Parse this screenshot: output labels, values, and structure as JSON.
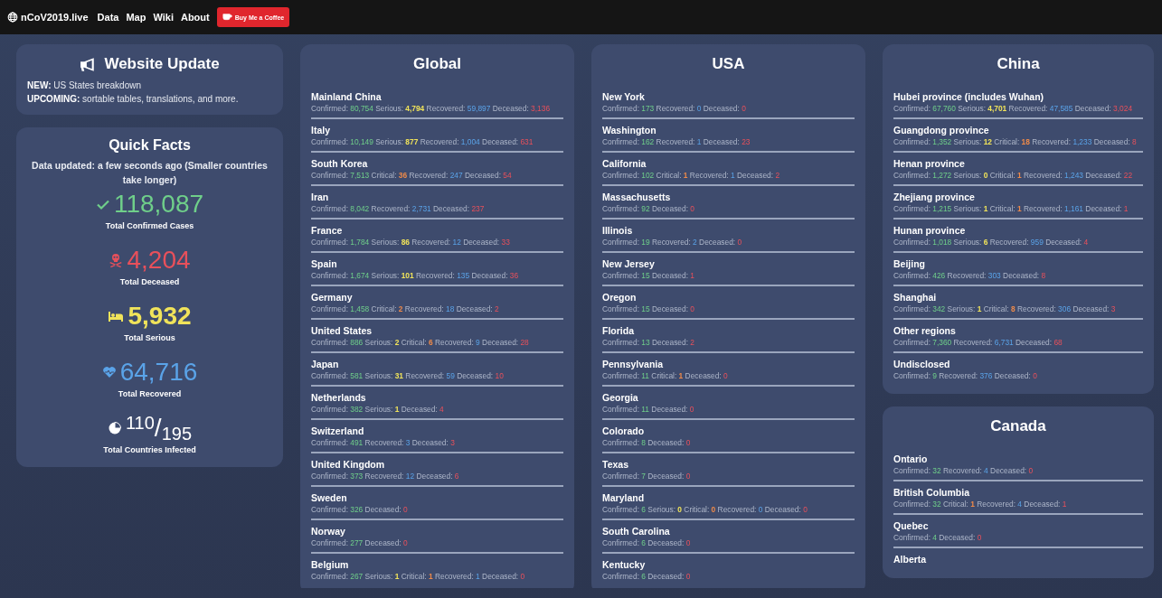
{
  "nav": {
    "brand": "nCoV2019.live",
    "links": [
      "Data",
      "Map",
      "Wiki",
      "About"
    ],
    "coffee_button": "Buy Me a Coffee"
  },
  "website_update": {
    "title": "Website Update",
    "lines": [
      "**NEW:** US States breakdown",
      "**UPCOMING:** sortable tables, translations, and more."
    ]
  },
  "quick_facts": {
    "title": "Quick Facts",
    "updated": "Data updated: a few seconds ago (Smaller countries take longer)",
    "facts": [
      {
        "kind": "confirmed",
        "value": "118,087",
        "label": "Total Confirmed Cases"
      },
      {
        "kind": "deceased",
        "value": "4,204",
        "label": "Total Deceased"
      },
      {
        "kind": "serious",
        "value": "5,932",
        "label": "Total Serious"
      },
      {
        "kind": "recovered",
        "value": "64,716",
        "label": "Total Recovered"
      },
      {
        "kind": "countries",
        "value": "$^{110}$/$_{195}$",
        "label": "Total Countries Infected"
      }
    ]
  },
  "region_columns": [
    {
      "panels": [
        {
          "title": "Global",
          "regions": [
            {
              "name": "Mainland China",
              "stats": [
                {
                  "kind": "confirmed",
                  "label": "Confirmed:",
                  "value": "80,754"
                },
                {
                  "kind": "serious",
                  "label": "Serious:",
                  "value": "4,794"
                },
                {
                  "kind": "recovered",
                  "label": "Recovered:",
                  "value": "59,897"
                },
                {
                  "kind": "deceased",
                  "label": "Deceased:",
                  "value": "3,136"
                }
              ]
            },
            {
              "name": "Italy",
              "stats": [
                {
                  "kind": "confirmed",
                  "label": "Confirmed:",
                  "value": "10,149"
                },
                {
                  "kind": "serious",
                  "label": "Serious:",
                  "value": "877"
                },
                {
                  "kind": "recovered",
                  "label": "Recovered:",
                  "value": "1,004"
                },
                {
                  "kind": "deceased",
                  "label": "Deceased:",
                  "value": "631"
                }
              ]
            },
            {
              "name": "South Korea",
              "stats": [
                {
                  "kind": "confirmed",
                  "label": "Confirmed:",
                  "value": "7,513"
                },
                {
                  "kind": "critical",
                  "label": "Critical:",
                  "value": "36"
                },
                {
                  "kind": "recovered",
                  "label": "Recovered:",
                  "value": "247"
                },
                {
                  "kind": "deceased",
                  "label": "Deceased:",
                  "value": "54"
                }
              ]
            },
            {
              "name": "Iran",
              "stats": [
                {
                  "kind": "confirmed",
                  "label": "Confirmed:",
                  "value": "8,042"
                },
                {
                  "kind": "recovered",
                  "label": "Recovered:",
                  "value": "2,731"
                },
                {
                  "kind": "deceased",
                  "label": "Deceased:",
                  "value": "237"
                }
              ]
            },
            {
              "name": "France",
              "stats": [
                {
                  "kind": "confirmed",
                  "label": "Confirmed:",
                  "value": "1,784"
                },
                {
                  "kind": "serious",
                  "label": "Serious:",
                  "value": "86"
                },
                {
                  "kind": "recovered",
                  "label": "Recovered:",
                  "value": "12"
                },
                {
                  "kind": "deceased",
                  "label": "Deceased:",
                  "value": "33"
                }
              ]
            },
            {
              "name": "Spain",
              "stats": [
                {
                  "kind": "confirmed",
                  "label": "Confirmed:",
                  "value": "1,674"
                },
                {
                  "kind": "serious",
                  "label": "Serious:",
                  "value": "101"
                },
                {
                  "kind": "recovered",
                  "label": "Recovered:",
                  "value": "135"
                },
                {
                  "kind": "deceased",
                  "label": "Deceased:",
                  "value": "36"
                }
              ]
            },
            {
              "name": "Germany",
              "stats": [
                {
                  "kind": "confirmed",
                  "label": "Confirmed:",
                  "value": "1,458"
                },
                {
                  "kind": "critical",
                  "label": "Critical:",
                  "value": "2"
                },
                {
                  "kind": "recovered",
                  "label": "Recovered:",
                  "value": "18"
                },
                {
                  "kind": "deceased",
                  "label": "Deceased:",
                  "value": "2"
                }
              ]
            },
            {
              "name": "United States",
              "stats": [
                {
                  "kind": "confirmed",
                  "label": "Confirmed:",
                  "value": "886"
                },
                {
                  "kind": "serious",
                  "label": "Serious:",
                  "value": "2"
                },
                {
                  "kind": "critical",
                  "label": "Critical:",
                  "value": "6"
                },
                {
                  "kind": "recovered",
                  "label": "Recovered:",
                  "value": "9"
                },
                {
                  "kind": "deceased",
                  "label": "Deceased:",
                  "value": "28"
                }
              ]
            },
            {
              "name": "Japan",
              "stats": [
                {
                  "kind": "confirmed",
                  "label": "Confirmed:",
                  "value": "581"
                },
                {
                  "kind": "serious",
                  "label": "Serious:",
                  "value": "31"
                },
                {
                  "kind": "recovered",
                  "label": "Recovered:",
                  "value": "59"
                },
                {
                  "kind": "deceased",
                  "label": "Deceased:",
                  "value": "10"
                }
              ]
            },
            {
              "name": "Netherlands",
              "stats": [
                {
                  "kind": "confirmed",
                  "label": "Confirmed:",
                  "value": "382"
                },
                {
                  "kind": "serious",
                  "label": "Serious:",
                  "value": "1"
                },
                {
                  "kind": "deceased",
                  "label": "Deceased:",
                  "value": "4"
                }
              ]
            },
            {
              "name": "Switzerland",
              "stats": [
                {
                  "kind": "confirmed",
                  "label": "Confirmed:",
                  "value": "491"
                },
                {
                  "kind": "recovered",
                  "label": "Recovered:",
                  "value": "3"
                },
                {
                  "kind": "deceased",
                  "label": "Deceased:",
                  "value": "3"
                }
              ]
            },
            {
              "name": "United Kingdom",
              "stats": [
                {
                  "kind": "confirmed",
                  "label": "Confirmed:",
                  "value": "373"
                },
                {
                  "kind": "recovered",
                  "label": "Recovered:",
                  "value": "12"
                },
                {
                  "kind": "deceased",
                  "label": "Deceased:",
                  "value": "6"
                }
              ]
            },
            {
              "name": "Sweden",
              "stats": [
                {
                  "kind": "confirmed",
                  "label": "Confirmed:",
                  "value": "326"
                },
                {
                  "kind": "deceased",
                  "label": "Deceased:",
                  "value": "0"
                }
              ]
            },
            {
              "name": "Norway",
              "stats": [
                {
                  "kind": "confirmed",
                  "label": "Confirmed:",
                  "value": "277"
                },
                {
                  "kind": "deceased",
                  "label": "Deceased:",
                  "value": "0"
                }
              ]
            },
            {
              "name": "Belgium",
              "stats": [
                {
                  "kind": "confirmed",
                  "label": "Confirmed:",
                  "value": "267"
                },
                {
                  "kind": "serious",
                  "label": "Serious:",
                  "value": "1"
                },
                {
                  "kind": "critical",
                  "label": "Critical:",
                  "value": "1"
                },
                {
                  "kind": "recovered",
                  "label": "Recovered:",
                  "value": "1"
                },
                {
                  "kind": "deceased",
                  "label": "Deceased:",
                  "value": "0"
                }
              ]
            }
          ]
        }
      ]
    },
    {
      "panels": [
        {
          "title": "USA",
          "regions": [
            {
              "name": "New York",
              "stats": [
                {
                  "kind": "confirmed",
                  "label": "Confirmed:",
                  "value": "173"
                },
                {
                  "kind": "recovered",
                  "label": "Recovered:",
                  "value": "0"
                },
                {
                  "kind": "deceased",
                  "label": "Deceased:",
                  "value": "0"
                }
              ]
            },
            {
              "name": "Washington",
              "stats": [
                {
                  "kind": "confirmed",
                  "label": "Confirmed:",
                  "value": "162"
                },
                {
                  "kind": "recovered",
                  "label": "Recovered:",
                  "value": "1"
                },
                {
                  "kind": "deceased",
                  "label": "Deceased:",
                  "value": "23"
                }
              ]
            },
            {
              "name": "California",
              "stats": [
                {
                  "kind": "confirmed",
                  "label": "Confirmed:",
                  "value": "102"
                },
                {
                  "kind": "critical",
                  "label": "Critical:",
                  "value": "1"
                },
                {
                  "kind": "recovered",
                  "label": "Recovered:",
                  "value": "1"
                },
                {
                  "kind": "deceased",
                  "label": "Deceased:",
                  "value": "2"
                }
              ]
            },
            {
              "name": "Massachusetts",
              "stats": [
                {
                  "kind": "confirmed",
                  "label": "Confirmed:",
                  "value": "92"
                },
                {
                  "kind": "deceased",
                  "label": "Deceased:",
                  "value": "0"
                }
              ]
            },
            {
              "name": "Illinois",
              "stats": [
                {
                  "kind": "confirmed",
                  "label": "Confirmed:",
                  "value": "19"
                },
                {
                  "kind": "recovered",
                  "label": "Recovered:",
                  "value": "2"
                },
                {
                  "kind": "deceased",
                  "label": "Deceased:",
                  "value": "0"
                }
              ]
            },
            {
              "name": "New Jersey",
              "stats": [
                {
                  "kind": "confirmed",
                  "label": "Confirmed:",
                  "value": "15"
                },
                {
                  "kind": "deceased",
                  "label": "Deceased:",
                  "value": "1"
                }
              ]
            },
            {
              "name": "Oregon",
              "stats": [
                {
                  "kind": "confirmed",
                  "label": "Confirmed:",
                  "value": "15"
                },
                {
                  "kind": "deceased",
                  "label": "Deceased:",
                  "value": "0"
                }
              ]
            },
            {
              "name": "Florida",
              "stats": [
                {
                  "kind": "confirmed",
                  "label": "Confirmed:",
                  "value": "13"
                },
                {
                  "kind": "deceased",
                  "label": "Deceased:",
                  "value": "2"
                }
              ]
            },
            {
              "name": "Pennsylvania",
              "stats": [
                {
                  "kind": "confirmed",
                  "label": "Confirmed:",
                  "value": "11"
                },
                {
                  "kind": "critical",
                  "label": "Critical:",
                  "value": "1"
                },
                {
                  "kind": "deceased",
                  "label": "Deceased:",
                  "value": "0"
                }
              ]
            },
            {
              "name": "Georgia",
              "stats": [
                {
                  "kind": "confirmed",
                  "label": "Confirmed:",
                  "value": "11"
                },
                {
                  "kind": "deceased",
                  "label": "Deceased:",
                  "value": "0"
                }
              ]
            },
            {
              "name": "Colorado",
              "stats": [
                {
                  "kind": "confirmed",
                  "label": "Confirmed:",
                  "value": "8"
                },
                {
                  "kind": "deceased",
                  "label": "Deceased:",
                  "value": "0"
                }
              ]
            },
            {
              "name": "Texas",
              "stats": [
                {
                  "kind": "confirmed",
                  "label": "Confirmed:",
                  "value": "7"
                },
                {
                  "kind": "deceased",
                  "label": "Deceased:",
                  "value": "0"
                }
              ]
            },
            {
              "name": "Maryland",
              "stats": [
                {
                  "kind": "confirmed",
                  "label": "Confirmed:",
                  "value": "6"
                },
                {
                  "kind": "serious",
                  "label": "Serious:",
                  "value": "0"
                },
                {
                  "kind": "critical",
                  "label": "Critical:",
                  "value": "0"
                },
                {
                  "kind": "recovered",
                  "label": "Recovered:",
                  "value": "0"
                },
                {
                  "kind": "deceased",
                  "label": "Deceased:",
                  "value": "0"
                }
              ]
            },
            {
              "name": "South Carolina",
              "stats": [
                {
                  "kind": "confirmed",
                  "label": "Confirmed:",
                  "value": "6"
                },
                {
                  "kind": "deceased",
                  "label": "Deceased:",
                  "value": "0"
                }
              ]
            },
            {
              "name": "Kentucky",
              "stats": [
                {
                  "kind": "confirmed",
                  "label": "Confirmed:",
                  "value": "6"
                },
                {
                  "kind": "deceased",
                  "label": "Deceased:",
                  "value": "0"
                }
              ]
            }
          ]
        }
      ]
    },
    {
      "panels": [
        {
          "title": "China",
          "regions": [
            {
              "name": "Hubei province (includes Wuhan)",
              "stats": [
                {
                  "kind": "confirmed",
                  "label": "Confirmed:",
                  "value": "67,760"
                },
                {
                  "kind": "serious",
                  "label": "Serious:",
                  "value": "4,701"
                },
                {
                  "kind": "recovered",
                  "label": "Recovered:",
                  "value": "47,585"
                },
                {
                  "kind": "deceased",
                  "label": "Deceased:",
                  "value": "3,024"
                }
              ]
            },
            {
              "name": "Guangdong province",
              "stats": [
                {
                  "kind": "confirmed",
                  "label": "Confirmed:",
                  "value": "1,352"
                },
                {
                  "kind": "serious",
                  "label": "Serious:",
                  "value": "12"
                },
                {
                  "kind": "critical",
                  "label": "Critical:",
                  "value": "18"
                },
                {
                  "kind": "recovered",
                  "label": "Recovered:",
                  "value": "1,233"
                },
                {
                  "kind": "deceased",
                  "label": "Deceased:",
                  "value": "8"
                }
              ]
            },
            {
              "name": "Henan province",
              "stats": [
                {
                  "kind": "confirmed",
                  "label": "Confirmed:",
                  "value": "1,272"
                },
                {
                  "kind": "serious",
                  "label": "Serious:",
                  "value": "0"
                },
                {
                  "kind": "critical",
                  "label": "Critical:",
                  "value": "1"
                },
                {
                  "kind": "recovered",
                  "label": "Recovered:",
                  "value": "1,243"
                },
                {
                  "kind": "deceased",
                  "label": "Deceased:",
                  "value": "22"
                }
              ]
            },
            {
              "name": "Zhejiang province",
              "stats": [
                {
                  "kind": "confirmed",
                  "label": "Confirmed:",
                  "value": "1,215"
                },
                {
                  "kind": "serious",
                  "label": "Serious:",
                  "value": "1"
                },
                {
                  "kind": "critical",
                  "label": "Critical:",
                  "value": "1"
                },
                {
                  "kind": "recovered",
                  "label": "Recovered:",
                  "value": "1,161"
                },
                {
                  "kind": "deceased",
                  "label": "Deceased:",
                  "value": "1"
                }
              ]
            },
            {
              "name": "Hunan province",
              "stats": [
                {
                  "kind": "confirmed",
                  "label": "Confirmed:",
                  "value": "1,018"
                },
                {
                  "kind": "serious",
                  "label": "Serious:",
                  "value": "6"
                },
                {
                  "kind": "recovered",
                  "label": "Recovered:",
                  "value": "959"
                },
                {
                  "kind": "deceased",
                  "label": "Deceased:",
                  "value": "4"
                }
              ]
            },
            {
              "name": "Beijing",
              "stats": [
                {
                  "kind": "confirmed",
                  "label": "Confirmed:",
                  "value": "426"
                },
                {
                  "kind": "recovered",
                  "label": "Recovered:",
                  "value": "303"
                },
                {
                  "kind": "deceased",
                  "label": "Deceased:",
                  "value": "8"
                }
              ]
            },
            {
              "name": "Shanghai",
              "stats": [
                {
                  "kind": "confirmed",
                  "label": "Confirmed:",
                  "value": "342"
                },
                {
                  "kind": "serious",
                  "label": "Serious:",
                  "value": "1"
                },
                {
                  "kind": "critical",
                  "label": "Critical:",
                  "value": "8"
                },
                {
                  "kind": "recovered",
                  "label": "Recovered:",
                  "value": "306"
                },
                {
                  "kind": "deceased",
                  "label": "Deceased:",
                  "value": "3"
                }
              ]
            },
            {
              "name": "Other regions",
              "stats": [
                {
                  "kind": "confirmed",
                  "label": "Confirmed:",
                  "value": "7,360"
                },
                {
                  "kind": "recovered",
                  "label": "Recovered:",
                  "value": "6,731"
                },
                {
                  "kind": "deceased",
                  "label": "Deceased:",
                  "value": "68"
                }
              ]
            },
            {
              "name": "Undisclosed",
              "stats": [
                {
                  "kind": "confirmed",
                  "label": "Confirmed:",
                  "value": "9"
                },
                {
                  "kind": "recovered",
                  "label": "Recovered:",
                  "value": "376"
                },
                {
                  "kind": "deceased",
                  "label": "Deceased:",
                  "value": "0"
                }
              ]
            }
          ]
        },
        {
          "title": "Canada",
          "regions": [
            {
              "name": "Ontario",
              "stats": [
                {
                  "kind": "confirmed",
                  "label": "Confirmed:",
                  "value": "32"
                },
                {
                  "kind": "recovered",
                  "label": "Recovered:",
                  "value": "4"
                },
                {
                  "kind": "deceased",
                  "label": "Deceased:",
                  "value": "0"
                }
              ]
            },
            {
              "name": "British Columbia",
              "stats": [
                {
                  "kind": "confirmed",
                  "label": "Confirmed:",
                  "value": "32"
                },
                {
                  "kind": "critical",
                  "label": "Critical:",
                  "value": "1"
                },
                {
                  "kind": "recovered",
                  "label": "Recovered:",
                  "value": "4"
                },
                {
                  "kind": "deceased",
                  "label": "Deceased:",
                  "value": "1"
                }
              ]
            },
            {
              "name": "Quebec",
              "stats": [
                {
                  "kind": "confirmed",
                  "label": "Confirmed:",
                  "value": "4"
                },
                {
                  "kind": "deceased",
                  "label": "Deceased:",
                  "value": "0"
                }
              ]
            },
            {
              "name": "Alberta"
            }
          ]
        }
      ]
    }
  ]
}
